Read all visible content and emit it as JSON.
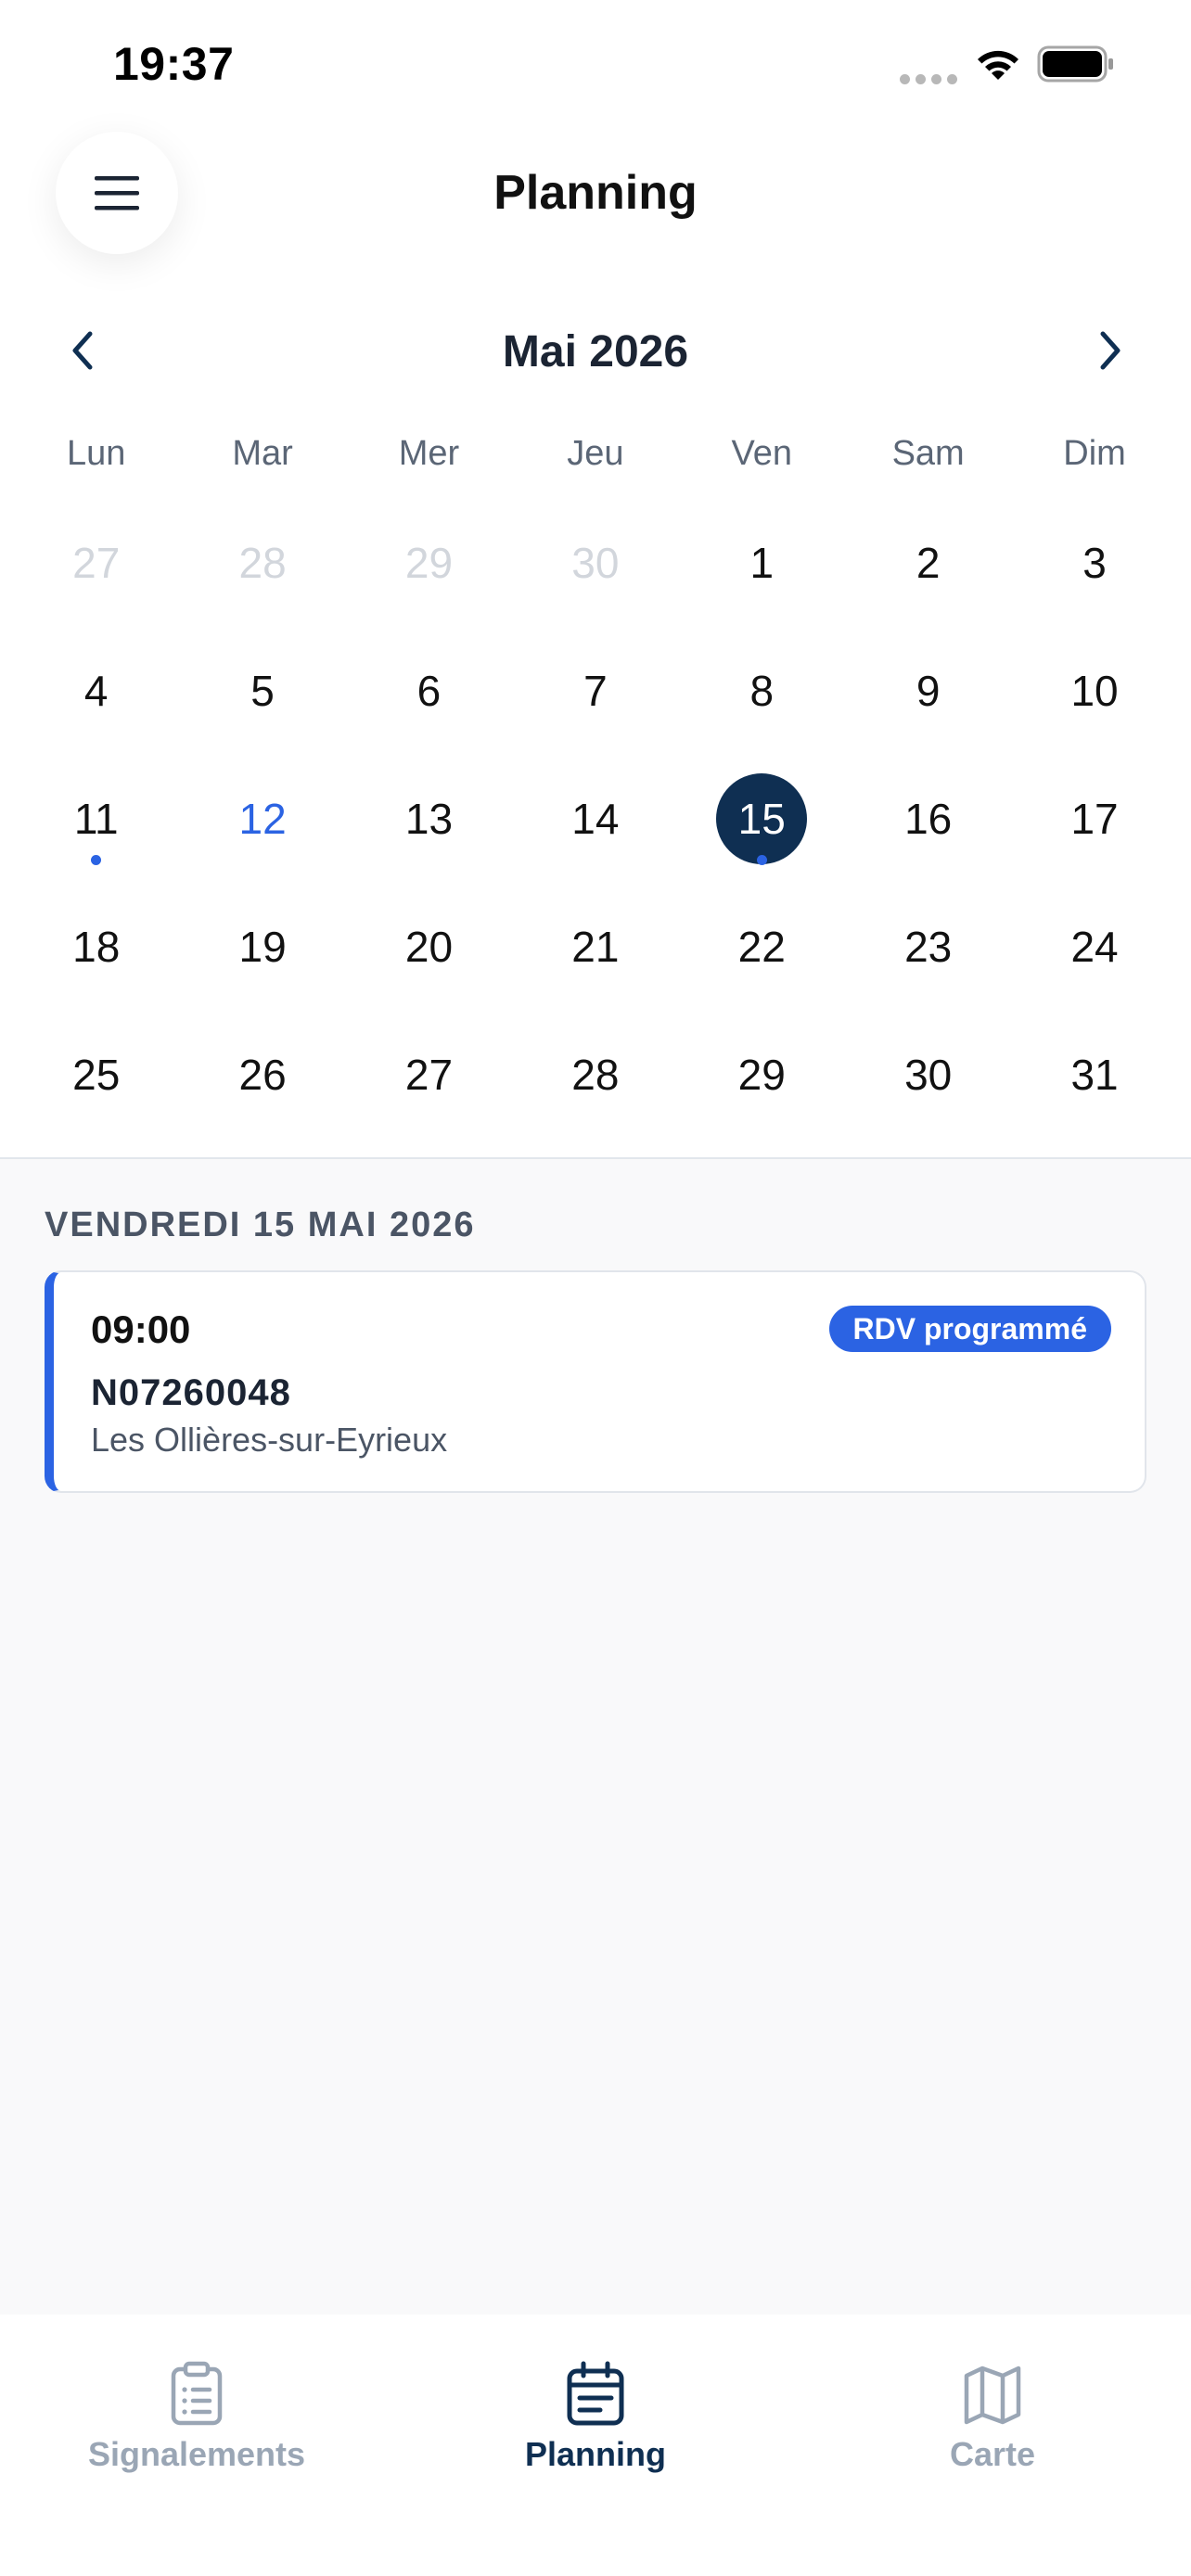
{
  "status_bar": {
    "time": "19:37"
  },
  "header": {
    "title": "Planning",
    "menu_icon": "hamburger-menu-icon"
  },
  "calendar": {
    "month_label": "Mai 2026",
    "prev_icon": "chevron-left-icon",
    "next_icon": "chevron-right-icon",
    "weekdays": [
      "Lun",
      "Mar",
      "Mer",
      "Jeu",
      "Ven",
      "Sam",
      "Dim"
    ],
    "weeks": [
      [
        {
          "d": "27",
          "outside": true
        },
        {
          "d": "28",
          "outside": true
        },
        {
          "d": "29",
          "outside": true
        },
        {
          "d": "30",
          "outside": true
        },
        {
          "d": "1"
        },
        {
          "d": "2"
        },
        {
          "d": "3"
        }
      ],
      [
        {
          "d": "4"
        },
        {
          "d": "5"
        },
        {
          "d": "6"
        },
        {
          "d": "7"
        },
        {
          "d": "8"
        },
        {
          "d": "9"
        },
        {
          "d": "10"
        }
      ],
      [
        {
          "d": "11",
          "dot": true
        },
        {
          "d": "12",
          "today": true
        },
        {
          "d": "13"
        },
        {
          "d": "14"
        },
        {
          "d": "15",
          "selected": true,
          "dot": true
        },
        {
          "d": "16"
        },
        {
          "d": "17"
        }
      ],
      [
        {
          "d": "18"
        },
        {
          "d": "19"
        },
        {
          "d": "20"
        },
        {
          "d": "21"
        },
        {
          "d": "22"
        },
        {
          "d": "23"
        },
        {
          "d": "24"
        }
      ],
      [
        {
          "d": "25"
        },
        {
          "d": "26"
        },
        {
          "d": "27"
        },
        {
          "d": "28"
        },
        {
          "d": "29"
        },
        {
          "d": "30"
        },
        {
          "d": "31"
        }
      ]
    ]
  },
  "agenda": {
    "date_header": "VENDREDI 15 MAI 2026",
    "events": [
      {
        "time": "09:00",
        "status": "RDV programmé",
        "reference": "N07260048",
        "place": "Les Ollières-sur-Eyrieux"
      }
    ]
  },
  "tab_bar": {
    "tabs": [
      {
        "label": "Signalements",
        "icon": "clipboard-list-icon",
        "active": false
      },
      {
        "label": "Planning",
        "icon": "calendar-icon",
        "active": true
      },
      {
        "label": "Carte",
        "icon": "map-icon",
        "active": false
      }
    ]
  },
  "colors": {
    "accent": "#2b63e3",
    "selected_day": "#0f2f52",
    "muted_day": "#d2d6dc",
    "tab_inactive": "#9aa6b5"
  }
}
